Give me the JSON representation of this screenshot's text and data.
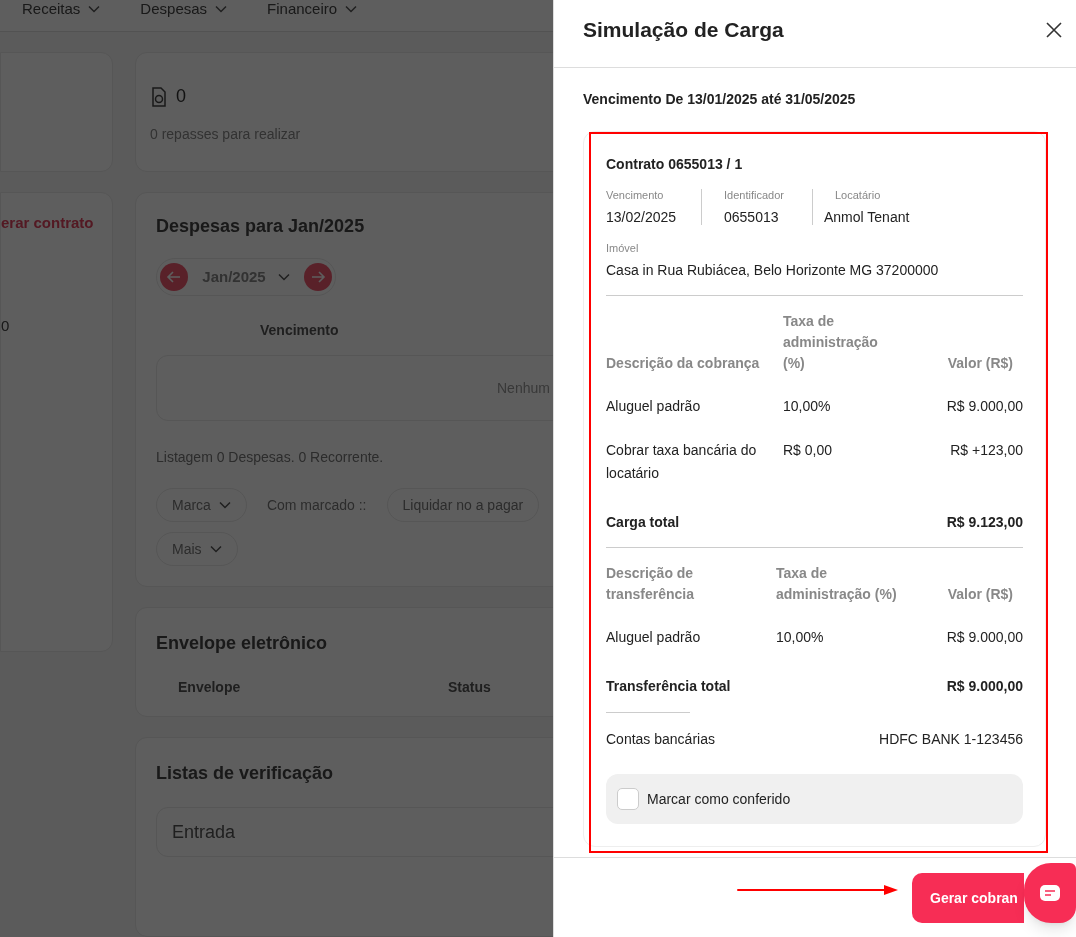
{
  "background": {
    "nav": [
      {
        "label": "Receitas"
      },
      {
        "label": "Despesas"
      },
      {
        "label": "Financeiro"
      }
    ],
    "summary": {
      "count": "0",
      "caption": "0 repasses para realizar"
    },
    "side_link": "erar contrato",
    "side_value": "0",
    "expenses": {
      "title": "Despesas para Jan/2025",
      "month": "Jan/2025",
      "column_1": "Vencimento",
      "empty_text": "Nenhum",
      "listing": "Listagem 0 Despesas. 0 Recorrente.",
      "filters": [
        {
          "label": "Marca",
          "kind": "dropdown"
        },
        {
          "label": "Com marcado ::",
          "kind": "text"
        },
        {
          "label": "Liquidar no a pagar",
          "kind": "button"
        },
        {
          "label": "Mais",
          "kind": "dropdown"
        }
      ]
    },
    "envelope": {
      "title": "Envelope eletrônico",
      "columns": [
        "Envelope",
        "Status"
      ]
    },
    "checklists": {
      "title": "Listas de verificação",
      "field_value": "Entrada"
    }
  },
  "drawer": {
    "title": "Simulação de Carga",
    "period": "Vencimento De 13/01/2025 até 31/05/2025",
    "contract": {
      "title": "Contrato 0655013 / 1",
      "fields": [
        {
          "label": "Vencimento",
          "value": "13/02/2025"
        },
        {
          "label": "Identificador",
          "value": "0655013"
        },
        {
          "label": "Locatário",
          "value": "Anmol Tenant"
        }
      ],
      "property": {
        "label": "Imóvel",
        "value": "Casa in Rua Rubiácea, Belo Horizonte MG 37200000"
      },
      "tables": [
        {
          "columns": [
            "Descrição da cobrança",
            "Taxa de administração (%)",
            "Valor (R$)"
          ],
          "rows": [
            [
              "Aluguel padrão",
              "10,00%",
              "R$ 9.000,00"
            ],
            [
              "Cobrar taxa bancária do locatário",
              "R$ 0,00",
              "R$ +123,00"
            ]
          ],
          "total": {
            "label": "Carga total",
            "value": "R$ 9.123,00"
          }
        },
        {
          "columns": [
            "Descrição de transferência",
            "Taxa de administração (%)",
            "Valor (R$)"
          ],
          "rows": [
            [
              "Aluguel padrão",
              "10,00%",
              "R$ 9.000,00"
            ]
          ],
          "total": {
            "label": "Transferência total",
            "value": "R$ 9.000,00"
          }
        }
      ],
      "bank": {
        "label": "Contas bancárias",
        "value": "HDFC BANK 1-123456"
      },
      "checkbox": {
        "label": "Marcar como conferido",
        "checked": false
      }
    },
    "primary_button": "Gerar cobran"
  }
}
